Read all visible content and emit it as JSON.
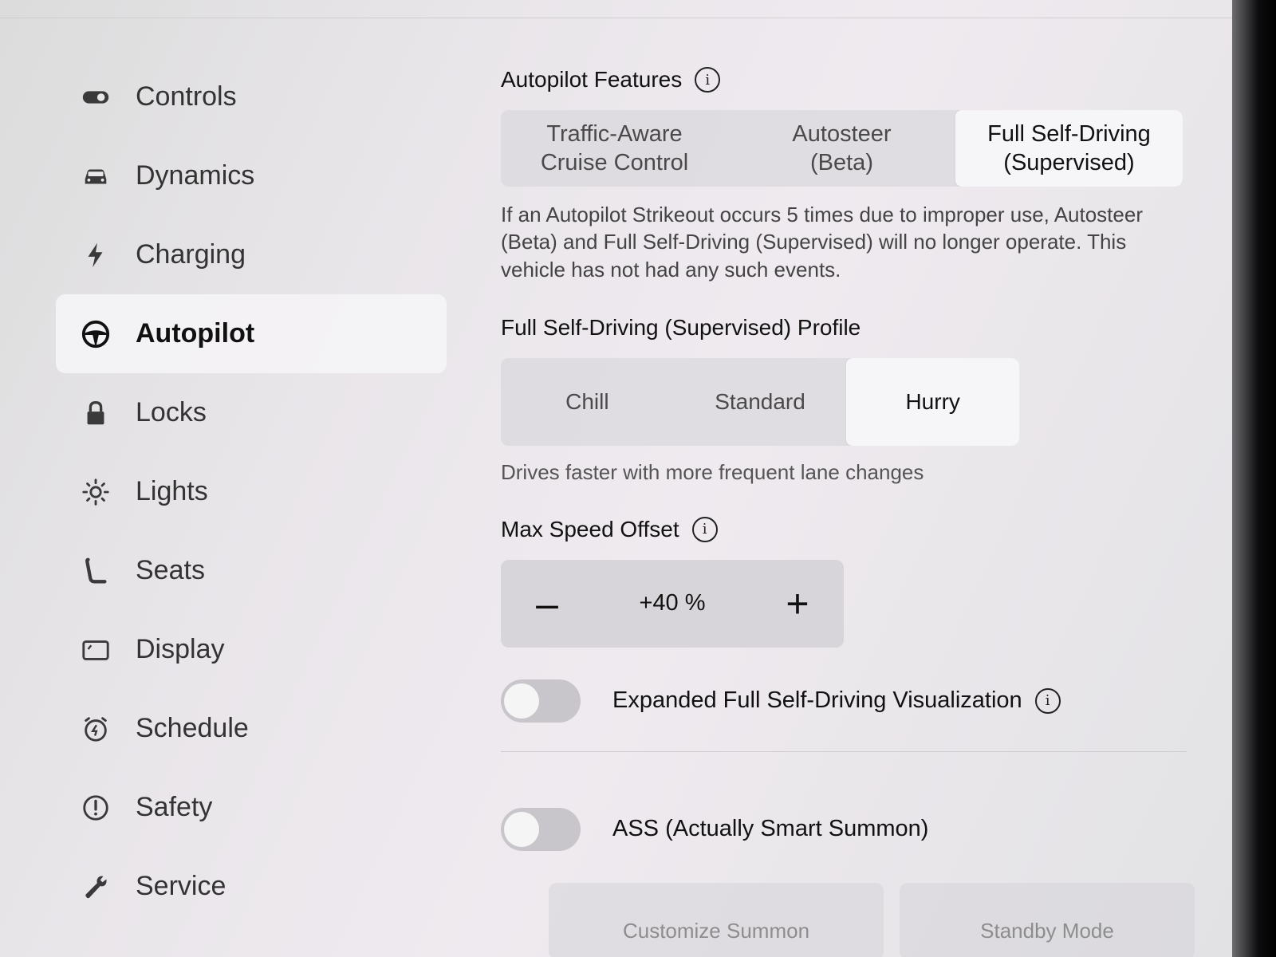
{
  "sidebar": {
    "items": [
      {
        "label": "Controls",
        "icon": "toggle-icon"
      },
      {
        "label": "Dynamics",
        "icon": "car-icon"
      },
      {
        "label": "Charging",
        "icon": "bolt-icon"
      },
      {
        "label": "Autopilot",
        "icon": "steering-wheel-icon",
        "active": true
      },
      {
        "label": "Locks",
        "icon": "lock-icon"
      },
      {
        "label": "Lights",
        "icon": "sun-icon"
      },
      {
        "label": "Seats",
        "icon": "seat-icon"
      },
      {
        "label": "Display",
        "icon": "display-icon"
      },
      {
        "label": "Schedule",
        "icon": "alarm-clock-icon"
      },
      {
        "label": "Safety",
        "icon": "alert-circle-icon"
      },
      {
        "label": "Service",
        "icon": "wrench-icon"
      }
    ]
  },
  "autopilot_features": {
    "title": "Autopilot Features",
    "options": [
      "Traffic-Aware\nCruise Control",
      "Autosteer\n(Beta)",
      "Full Self-Driving\n(Supervised)"
    ],
    "selected": "Full Self-Driving\n(Supervised)",
    "description": "If an Autopilot Strikeout occurs 5 times due to improper use, Autosteer (Beta) and Full Self-Driving (Supervised) will no longer operate. This vehicle has not had any such events."
  },
  "fsd_profile": {
    "title": "Full Self-Driving (Supervised) Profile",
    "options": [
      "Chill",
      "Standard",
      "Hurry"
    ],
    "selected": "Hurry",
    "description": "Drives faster with more frequent lane changes"
  },
  "max_speed_offset": {
    "title": "Max Speed Offset",
    "minus": "–",
    "plus": "+",
    "value": "+40 %"
  },
  "toggles": {
    "expanded_viz": {
      "label": "Expanded Full Self-Driving Visualization",
      "on": false
    },
    "ass": {
      "label": "ASS (Actually Smart Summon)",
      "on": false
    }
  },
  "buttons": {
    "customize_summon": "Customize Summon",
    "standby_mode": "Standby Mode"
  },
  "info_glyph": "i"
}
